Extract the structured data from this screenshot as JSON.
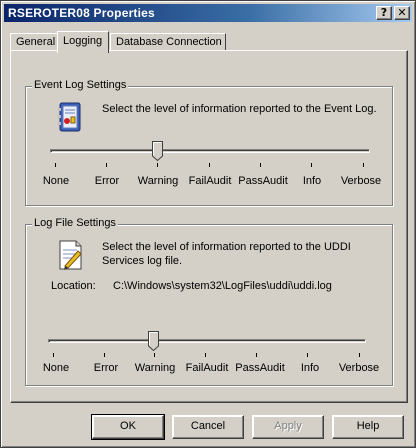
{
  "window": {
    "title": "RSEROTER08 Properties",
    "help_glyph": "?",
    "close_glyph": "✕"
  },
  "tabs": [
    {
      "label": "General",
      "active": false
    },
    {
      "label": "Logging",
      "active": true
    },
    {
      "label": "Database Connection",
      "active": false
    }
  ],
  "event_log": {
    "heading": "Event Log Settings",
    "description": "Select the level of information reported to the Event Log.",
    "levels": [
      "None",
      "Error",
      "Warning",
      "FailAudit",
      "PassAudit",
      "Info",
      "Verbose"
    ],
    "selected_level": "Warning",
    "selected_index": 2
  },
  "log_file": {
    "heading": "Log File Settings",
    "description": "Select the level of information reported to the UDDI Services log file.",
    "location_label": "Location:",
    "location_value": "C:\\Windows\\system32\\LogFiles\\uddi\\uddi.log",
    "levels": [
      "None",
      "Error",
      "Warning",
      "FailAudit",
      "PassAudit",
      "Info",
      "Verbose"
    ],
    "selected_level": "Warning",
    "selected_index": 2
  },
  "buttons": {
    "ok": "OK",
    "cancel": "Cancel",
    "apply": "Apply",
    "help": "Help"
  }
}
